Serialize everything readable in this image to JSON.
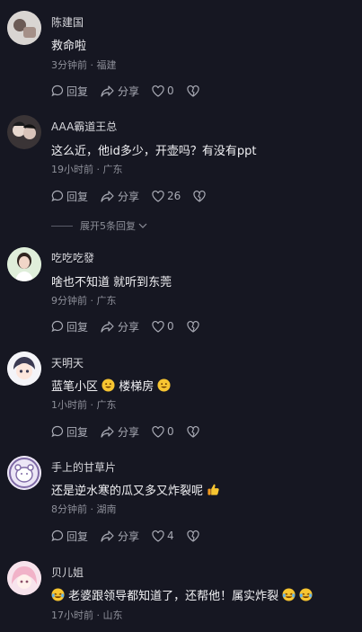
{
  "comments": [
    {
      "user": "陈建国",
      "text": "救命啦",
      "time": "3分钟前",
      "location": "福建",
      "reply": "回复",
      "share": "分享",
      "likes": "0"
    },
    {
      "user": "AAA霸道王总",
      "text": "这么近，他id多少，开壶吗？有没有ppt",
      "time": "19小时前",
      "location": "广东",
      "reply": "回复",
      "share": "分享",
      "likes": "26"
    },
    {
      "user": "吃吃吃發",
      "text": "啥也不知道 就听到东莞",
      "time": "9分钟前",
      "location": "广东",
      "reply": "回复",
      "share": "分享",
      "likes": "0"
    },
    {
      "user": "天明天",
      "text_a": "蓝笔小区",
      "text_b": "楼梯房",
      "time": "1小时前",
      "location": "广东",
      "reply": "回复",
      "share": "分享",
      "likes": "0"
    },
    {
      "user": "手上的甘草片",
      "text": "还是逆水寒的瓜又多又炸裂呢",
      "time": "8分钟前",
      "location": "湖南",
      "reply": "回复",
      "share": "分享",
      "likes": "4"
    },
    {
      "user": "贝儿姐",
      "text": "老婆跟领导都知道了，还帮他！属实炸裂",
      "time": "17小时前",
      "location": "山东"
    }
  ],
  "expand_replies": "展开5条回复",
  "meta_sep": "·"
}
